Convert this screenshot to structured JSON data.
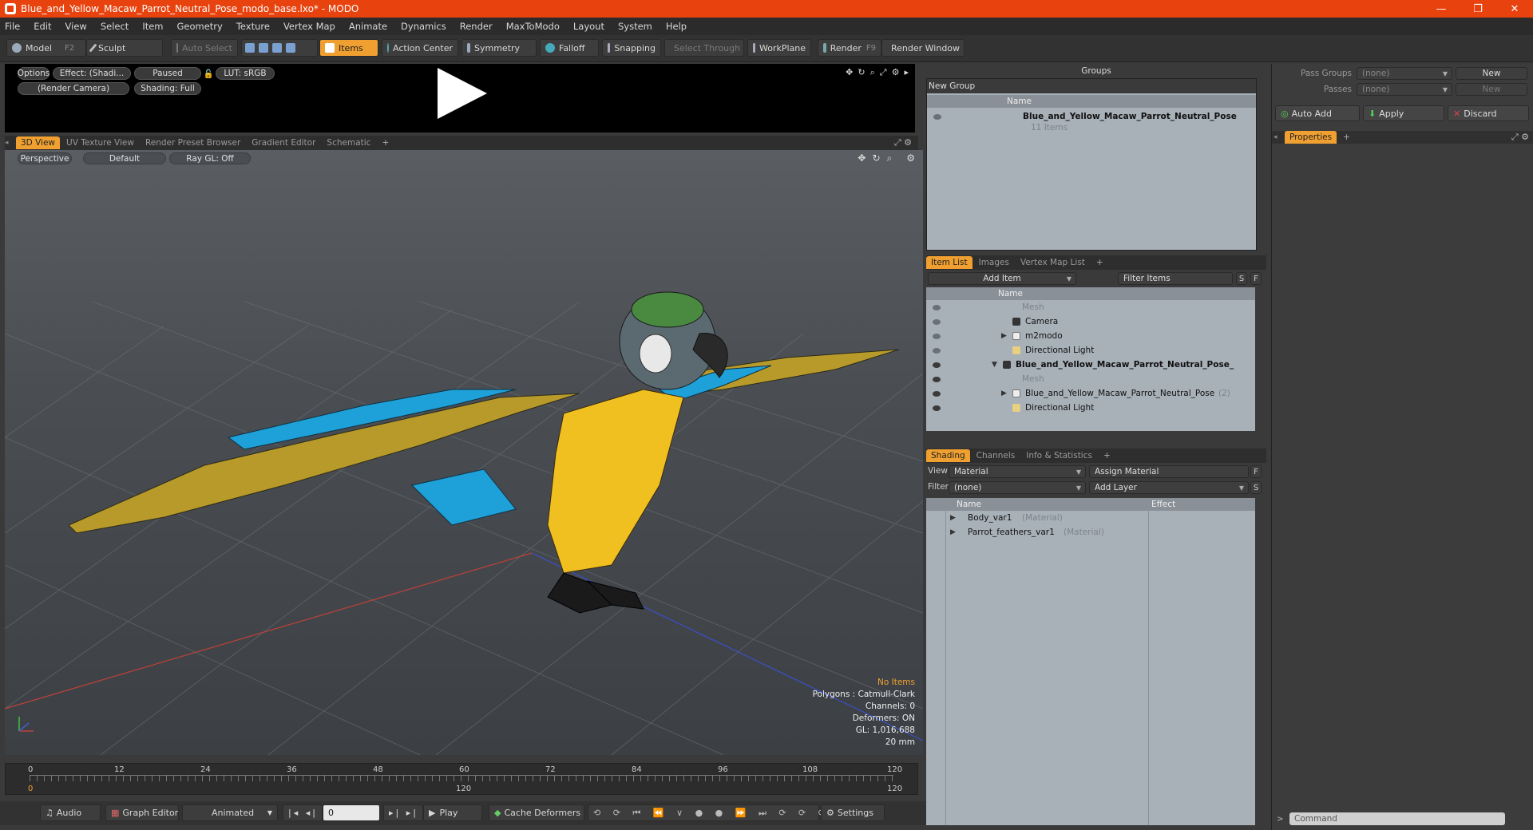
{
  "window": {
    "title": "Blue_and_Yellow_Macaw_Parrot_Neutral_Pose_modo_base.lxo* - MODO",
    "controls": [
      "—",
      "❐",
      "✕"
    ]
  },
  "menu": [
    "File",
    "Edit",
    "View",
    "Select",
    "Item",
    "Geometry",
    "Texture",
    "Vertex Map",
    "Animate",
    "Dynamics",
    "Render",
    "MaxToModo",
    "Layout",
    "System",
    "Help"
  ],
  "toolbar": {
    "model": "Model",
    "model_hotkey": "F2",
    "sculpt": "Sculpt",
    "auto_select": "Auto Select",
    "items": "Items",
    "action_center": "Action Center",
    "symmetry": "Symmetry",
    "falloff": "Falloff",
    "snapping": "Snapping",
    "select_through": "Select Through",
    "workplane": "WorkPlane",
    "render": "Render",
    "render_hotkey": "F9",
    "render_window": "Render Window"
  },
  "preview": {
    "options": "Options",
    "effect": "Effect: (Shadi...",
    "paused": "Paused",
    "lut": "LUT: sRGB",
    "camera": "(Render Camera)",
    "shading": "Shading: Full"
  },
  "viewport_tabs": [
    "3D View",
    "UV Texture View",
    "Render Preset Browser",
    "Gradient Editor",
    "Schematic",
    "+"
  ],
  "viewport": {
    "projection": "Perspective",
    "style": "Default",
    "raygl": "Ray GL: Off",
    "info": {
      "selection": "No Items",
      "polygons": "Polygons : Catmull-Clark",
      "channels": "Channels: 0",
      "deformers": "Deformers: ON",
      "gl": "GL: 1,016,688",
      "scale": "20 mm"
    }
  },
  "timeline": {
    "ticks": [
      "0",
      "12",
      "24",
      "36",
      "48",
      "60",
      "72",
      "84",
      "96",
      "108",
      "120"
    ],
    "end_left": "120",
    "end_mid": "120",
    "end_right": "120"
  },
  "bottom": {
    "audio": "Audio",
    "graph_editor": "Graph Editor",
    "animated": "Animated",
    "frame": "0",
    "play": "Play",
    "cache": "Cache Deformers",
    "settings": "Settings"
  },
  "groups": {
    "title": "Groups",
    "new_group": "New Group",
    "col_name": "Name",
    "item_name": "Blue_and_Yellow_Macaw_Parrot_Neutral_Pose",
    "item_count": "11 Items"
  },
  "item_list": {
    "tabs": [
      "Item List",
      "Images",
      "Vertex Map List",
      "+"
    ],
    "add_item": "Add Item",
    "filter": "Filter Items",
    "s_btn": "S",
    "f_btn": "F",
    "col_name": "Name",
    "rows": [
      {
        "label": "Mesh",
        "dim": true,
        "sub": ""
      },
      {
        "label": "Camera",
        "dim": false,
        "sub": ""
      },
      {
        "label": "m2modo",
        "dim": false,
        "sub": ""
      },
      {
        "label": "Directional Light",
        "dim": false,
        "sub": ""
      },
      {
        "label": "Blue_and_Yellow_Macaw_Parrot_Neutral_Pose_",
        "dim": false,
        "sub": ""
      },
      {
        "label": "Mesh",
        "dim": true,
        "sub": ""
      },
      {
        "label": "Blue_and_Yellow_Macaw_Parrot_Neutral_Pose",
        "dim": false,
        "sub": "(2)"
      },
      {
        "label": "Directional Light",
        "dim": false,
        "sub": ""
      }
    ]
  },
  "shading": {
    "tabs": [
      "Shading",
      "Channels",
      "Info & Statistics",
      "+"
    ],
    "view_label": "View",
    "view_value": "Material",
    "assign": "Assign Material",
    "filter_label": "Filter",
    "filter_value": "(none)",
    "add_layer": "Add Layer",
    "f_btn": "F",
    "s_btn": "S",
    "col_name": "Name",
    "col_effect": "Effect",
    "rows": [
      {
        "label": "Body_var1",
        "sub": "(Material)"
      },
      {
        "label": "Parrot_feathers_var1",
        "sub": "(Material)"
      }
    ]
  },
  "right": {
    "pass_groups_label": "Pass Groups",
    "pass_groups_value": "(none)",
    "new": "New",
    "passes_label": "Passes",
    "passes_value": "(none)",
    "new2": "New",
    "auto_add": "Auto Add",
    "apply": "Apply",
    "discard": "Discard",
    "properties_tab": "Properties",
    "plus": "+",
    "command_placeholder": "Command"
  },
  "colors": {
    "accent": "#f0a030",
    "titlebar": "#e8420e",
    "x_axis": "#c0403a",
    "z_axis": "#3a50c8",
    "macaw_yellow": "#f0c020",
    "macaw_blue": "#1ea0d8"
  }
}
